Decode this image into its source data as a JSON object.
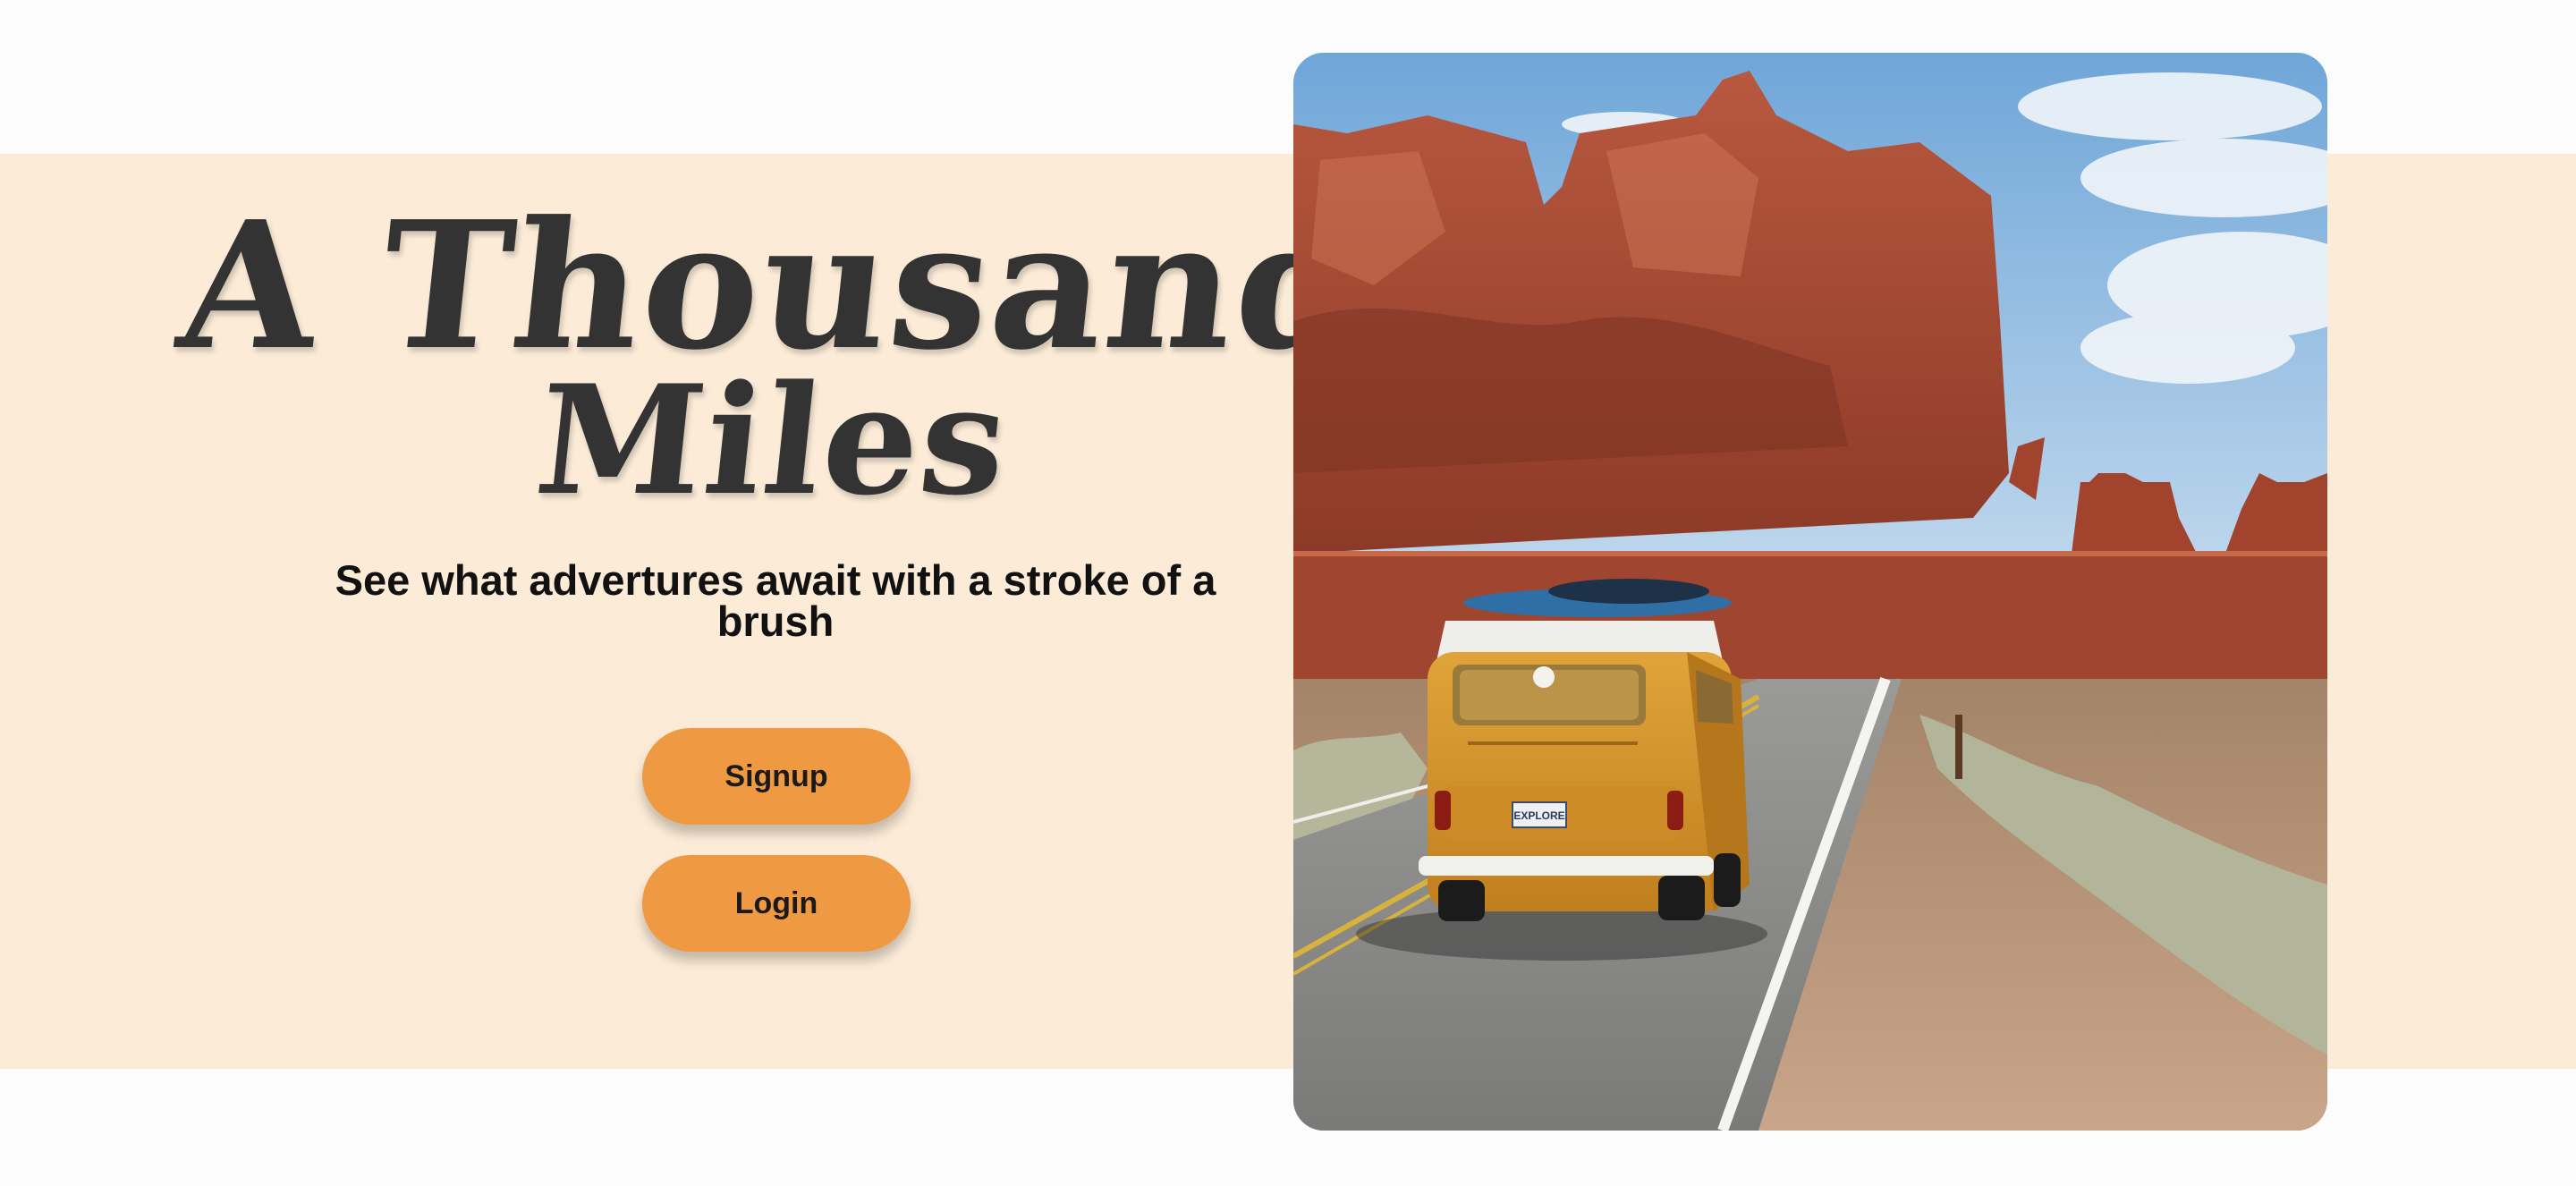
{
  "hero": {
    "title_line1": "A Thousand",
    "title_line2": "Miles",
    "subtitle": "See what advertures await with a stroke of a brush",
    "signup_label": "Signup",
    "login_label": "Login"
  },
  "image": {
    "license_plate": "EXPLORE"
  },
  "colors": {
    "band": "#fbebd7",
    "button": "#ef9a43",
    "title": "#333333",
    "background": "#fdfcfc"
  }
}
